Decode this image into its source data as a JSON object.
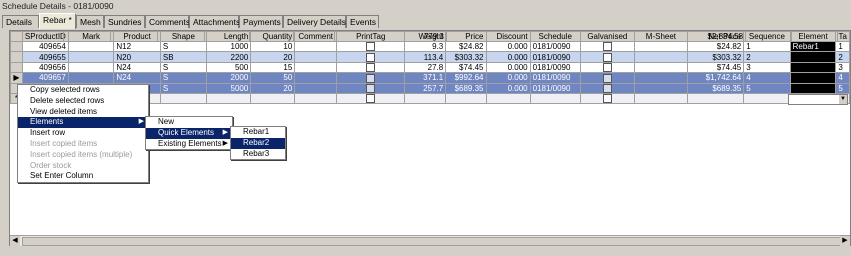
{
  "window": {
    "title": "Schedule Details - 0181/0090"
  },
  "tabs": [
    {
      "label": "Details"
    },
    {
      "label": "Rebar *"
    },
    {
      "label": "Mesh"
    },
    {
      "label": "Sundries"
    },
    {
      "label": "Comments"
    },
    {
      "label": "Attachments"
    },
    {
      "label": "Payments"
    },
    {
      "label": "Delivery Details"
    },
    {
      "label": "Events"
    }
  ],
  "grid": {
    "columns": [
      "SProductID",
      "Mark",
      "Product",
      "Shape",
      "Length",
      "Quantity",
      "Comment",
      "PrintTag",
      "Weight",
      "Price",
      "Discount",
      "Schedule",
      "Galvanised",
      "M-Sheet",
      "Net Price",
      "Sequence",
      "Element",
      "Ta"
    ],
    "rows": [
      {
        "id": "409654",
        "mark": "",
        "product": "N12",
        "shape": "S",
        "length": "1000",
        "qty": "10",
        "comment": "",
        "weight": "9.3",
        "price": "$24.82",
        "discount": "0.000",
        "schedule": "0181/0090",
        "msheet": "",
        "net": "$24.82",
        "seq": "1",
        "element": "Rebar1",
        "ta": "1"
      },
      {
        "id": "409655",
        "mark": "",
        "product": "N20",
        "shape": "SB",
        "length": "2200",
        "qty": "20",
        "comment": "",
        "weight": "113.4",
        "price": "$303.32",
        "discount": "0.000",
        "schedule": "0181/0090",
        "msheet": "",
        "net": "$303.32",
        "seq": "2",
        "element": "",
        "ta": "2"
      },
      {
        "id": "409656",
        "mark": "",
        "product": "N24",
        "shape": "S",
        "length": "500",
        "qty": "15",
        "comment": "",
        "weight": "27.8",
        "price": "$74.45",
        "discount": "0.000",
        "schedule": "0181/0090",
        "msheet": "",
        "net": "$74.45",
        "seq": "3",
        "element": "",
        "ta": "3"
      },
      {
        "id": "409657",
        "mark": "",
        "product": "N24",
        "shape": "S",
        "length": "2000",
        "qty": "50",
        "comment": "",
        "weight": "371.1",
        "price": "$992.64",
        "discount": "0.000",
        "schedule": "0181/0090",
        "msheet": "",
        "net": "$1,742.64",
        "seq": "4",
        "element": "",
        "ta": "4"
      },
      {
        "id": "",
        "mark": "",
        "product": "",
        "shape": "S",
        "length": "5000",
        "qty": "20",
        "comment": "",
        "weight": "257.7",
        "price": "$689.35",
        "discount": "0.000",
        "schedule": "0181/0090",
        "msheet": "",
        "net": "$689.35",
        "seq": "5",
        "element": "",
        "ta": "5"
      }
    ],
    "totals": {
      "weight": "779.3",
      "net": "$2,834.58"
    }
  },
  "context_menu": {
    "items": [
      {
        "label": "Copy selected rows"
      },
      {
        "label": "Delete selected rows"
      },
      {
        "label": "View deleted items"
      },
      {
        "label": "Elements"
      },
      {
        "label": "Insert row"
      },
      {
        "label": "Insert copied items"
      },
      {
        "label": "Insert copied items (multiple)"
      },
      {
        "label": "Order stock"
      },
      {
        "label": "Set Enter Column"
      }
    ],
    "elements_sub": [
      {
        "label": "New"
      },
      {
        "label": "Quick Elements"
      },
      {
        "label": "Existing Elements"
      }
    ],
    "quick_sub": [
      {
        "label": "Rebar1"
      },
      {
        "label": "Rebar2"
      },
      {
        "label": "Rebar3"
      }
    ]
  }
}
